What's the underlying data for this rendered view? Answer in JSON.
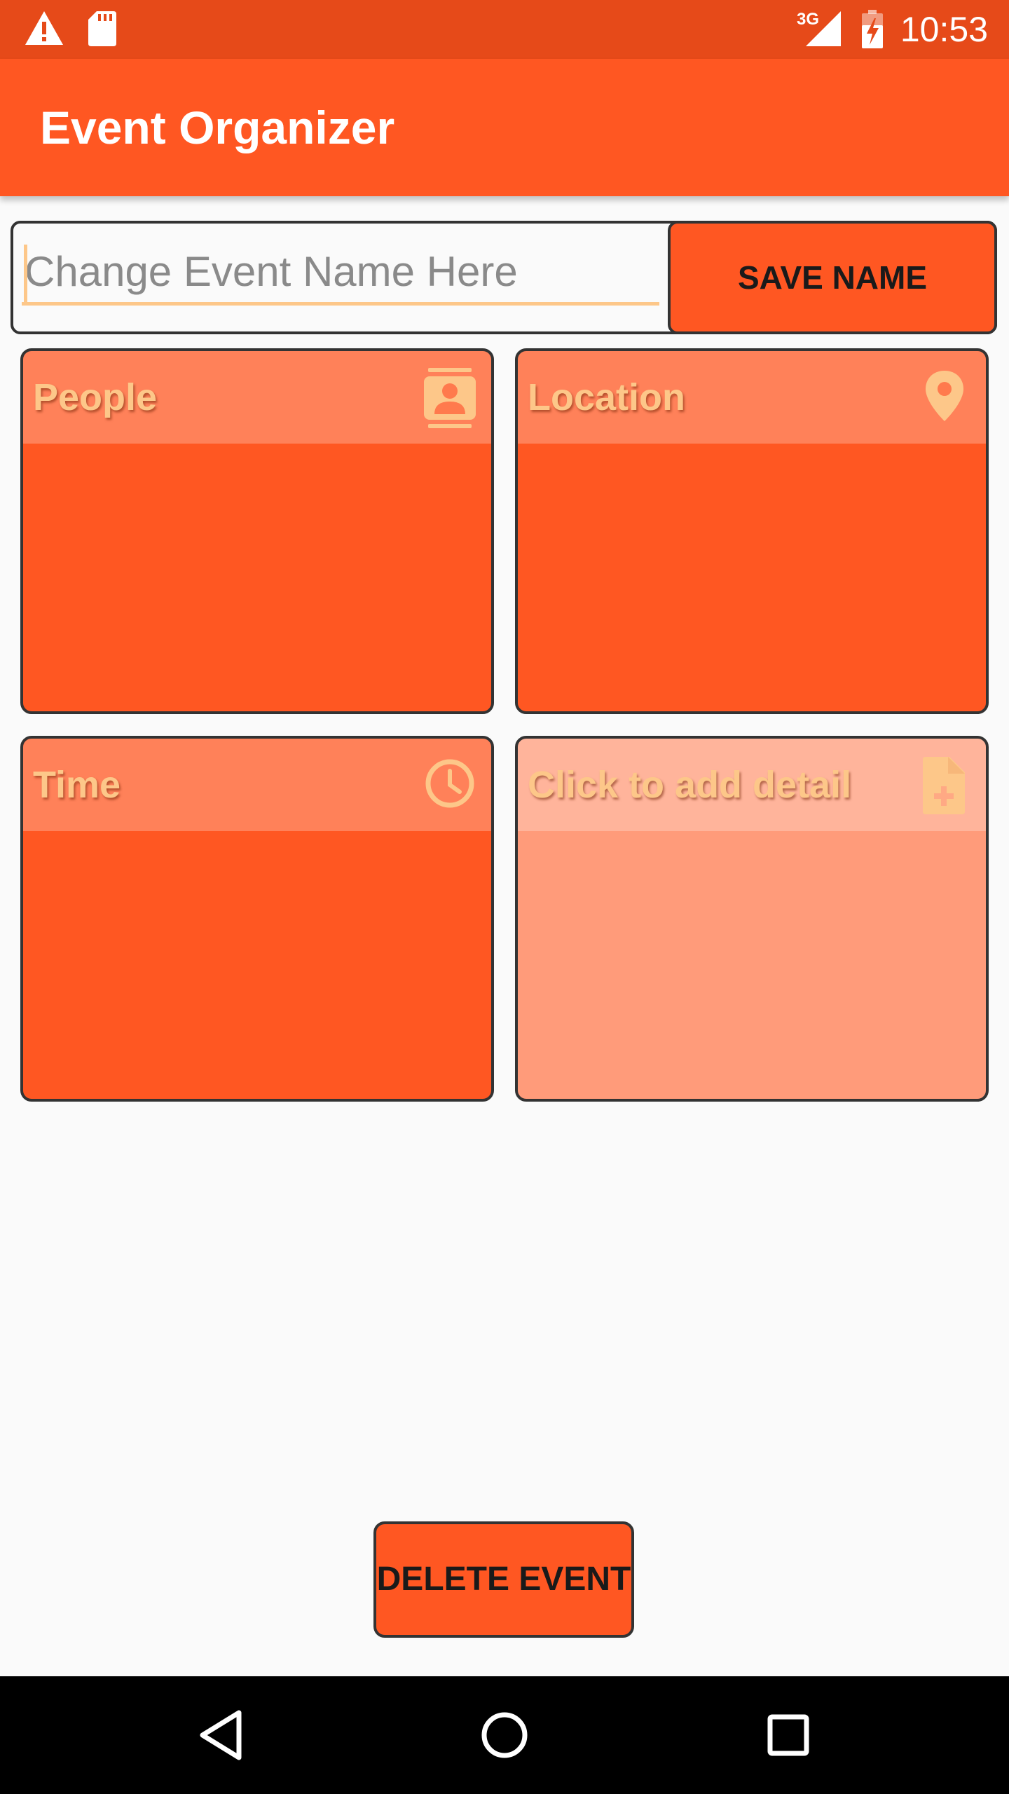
{
  "status_bar": {
    "time": "10:53",
    "network_label": "3G",
    "icons": [
      "warning-icon",
      "sd-card-icon",
      "signal-icon",
      "battery-charging-icon"
    ]
  },
  "app_bar": {
    "title": "Event Organizer"
  },
  "event_name": {
    "placeholder": "Change Event Name Here",
    "value": "",
    "save_label": "SAVE NAME"
  },
  "tiles": [
    {
      "label": "People",
      "icon": "contacts-icon"
    },
    {
      "label": "Location",
      "icon": "location-pin-icon"
    },
    {
      "label": "Time",
      "icon": "clock-icon"
    },
    {
      "label": "Click to add detail",
      "icon": "add-document-icon"
    }
  ],
  "delete_label": "DELETE EVENT",
  "nav": {
    "icons": [
      "back-icon",
      "home-icon",
      "recents-icon"
    ]
  },
  "colors": {
    "status_bar": "#e64a19",
    "primary": "#ff5722",
    "accent_text": "#fdc789",
    "faded_tile": "#ff9b7a",
    "border": "#333333"
  }
}
